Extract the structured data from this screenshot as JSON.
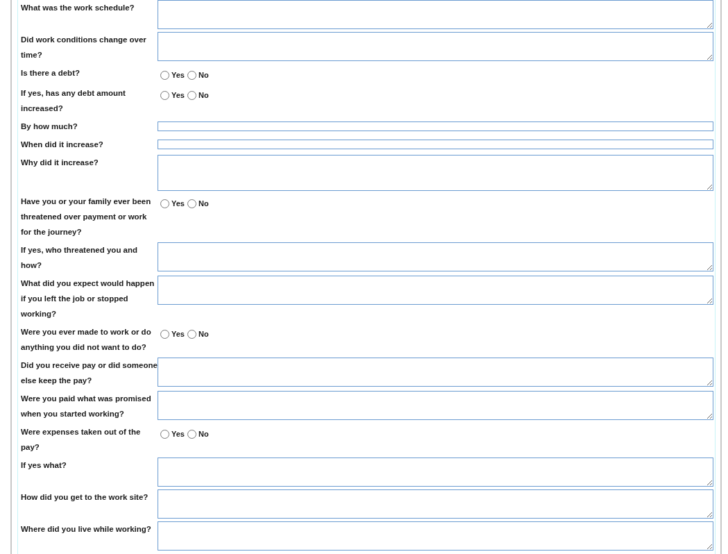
{
  "questions": [
    {
      "label": "What was the work schedule?",
      "kind": "textarea"
    },
    {
      "label": "Did work conditions change over time?",
      "kind": "textarea"
    },
    {
      "label": "Is there a debt?",
      "kind": "radio",
      "options": [
        {
          "label": "Yes",
          "selected": false
        },
        {
          "label": "No",
          "selected": false
        }
      ]
    },
    {
      "label": "If yes, has any debt amount increased?",
      "kind": "radio",
      "options": [
        {
          "label": "Yes",
          "selected": false
        },
        {
          "label": "No",
          "selected": false
        }
      ]
    },
    {
      "label": "By how much?",
      "kind": "input"
    },
    {
      "label": "When did it increase?",
      "kind": "input"
    },
    {
      "label": "Why did it increase?",
      "kind": "tall-textarea"
    },
    {
      "label": "Have you or your family ever been threatened over payment or work for the journey?",
      "kind": "radio",
      "options": [
        {
          "label": "Yes",
          "selected": false
        },
        {
          "label": "No",
          "selected": false
        }
      ]
    },
    {
      "label": "If yes, who threatened you and how?",
      "kind": "textarea"
    },
    {
      "label": "What did you expect would happen if you left the job or stopped working?",
      "kind": "textarea"
    },
    {
      "label": "Were you ever made to work or do anything you did not want to do?",
      "kind": "radio",
      "options": [
        {
          "label": "Yes",
          "selected": false
        },
        {
          "label": "No",
          "selected": false
        }
      ]
    },
    {
      "label": "Did you receive pay or did someone else keep the pay?",
      "kind": "textarea"
    },
    {
      "label": "Were you paid what was promised when you started working?",
      "kind": "textarea"
    },
    {
      "label": "Were expenses taken out of the pay?",
      "kind": "radio",
      "options": [
        {
          "label": "Yes",
          "selected": false
        },
        {
          "label": "No",
          "selected": false
        }
      ]
    },
    {
      "label": "If yes what?",
      "kind": "textarea"
    },
    {
      "label": "How did you get to the work site?",
      "kind": "textarea"
    },
    {
      "label": "Where did you live while working?",
      "kind": "textarea"
    }
  ]
}
